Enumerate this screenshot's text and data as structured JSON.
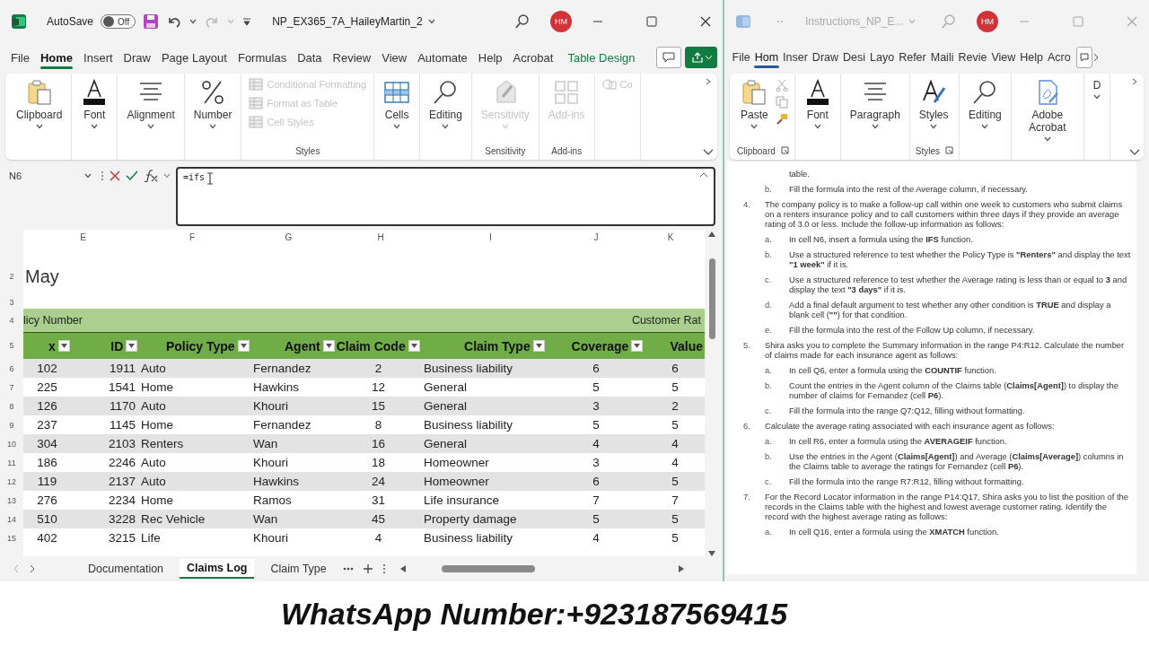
{
  "excel": {
    "active": true,
    "title_bar": {
      "autosave": {
        "label": "AutoSave",
        "state": "Off",
        "on": false
      },
      "file_name": "NP_EX365_7A_HaileyMartin_2",
      "avatar": "HM"
    },
    "tabs": [
      {
        "label": "File",
        "selected": false,
        "kind": "plain"
      },
      {
        "label": "Home",
        "selected": true,
        "kind": "plain"
      },
      {
        "label": "Insert",
        "selected": false,
        "kind": "plain"
      },
      {
        "label": "Draw",
        "selected": false,
        "kind": "plain"
      },
      {
        "label": "Page Layout",
        "selected": false,
        "kind": "plain"
      },
      {
        "label": "Formulas",
        "selected": false,
        "kind": "plain"
      },
      {
        "label": "Data",
        "selected": false,
        "kind": "plain"
      },
      {
        "label": "Review",
        "selected": false,
        "kind": "plain"
      },
      {
        "label": "View",
        "selected": false,
        "kind": "plain"
      },
      {
        "label": "Automate",
        "selected": false,
        "kind": "plain"
      },
      {
        "label": "Help",
        "selected": false,
        "kind": "plain"
      },
      {
        "label": "Acrobat",
        "selected": false,
        "kind": "plain"
      },
      {
        "label": "Table Design",
        "selected": false,
        "kind": "contextual"
      }
    ],
    "ribbon": [
      {
        "items": [
          {
            "label": "Clipboard",
            "kind": "big",
            "disabled": false
          }
        ]
      },
      {
        "items": [
          {
            "label": "Font",
            "kind": "big",
            "disabled": false
          }
        ]
      },
      {
        "items": [
          {
            "label": "Alignment",
            "kind": "big",
            "disabled": false
          }
        ]
      },
      {
        "items": [
          {
            "label": "Number",
            "kind": "big",
            "disabled": false
          }
        ]
      },
      {
        "label": "Styles",
        "items": [
          {
            "label": "Conditional Formatting",
            "kind": "small",
            "disabled": true
          },
          {
            "label": "Format as Table",
            "kind": "small",
            "disabled": true
          },
          {
            "label": "Cell Styles",
            "kind": "small",
            "disabled": true
          }
        ]
      },
      {
        "items": [
          {
            "label": "Cells",
            "kind": "big",
            "disabled": false
          }
        ]
      },
      {
        "items": [
          {
            "label": "Editing",
            "kind": "big",
            "disabled": false
          }
        ]
      },
      {
        "label": "Sensitivity",
        "items": [
          {
            "label": "Sensitivity",
            "kind": "big",
            "disabled": true
          }
        ]
      },
      {
        "label": "Add-ins",
        "items": [
          {
            "label": "Add-ins",
            "kind": "big",
            "disabled": true
          }
        ]
      },
      {
        "items": [
          {
            "label": "Co",
            "kind": "small",
            "disabled": true
          }
        ]
      }
    ],
    "formula_bar": {
      "name_box": "N6",
      "formula": "=ifs"
    },
    "sheet": {
      "column_letters": [
        "E",
        "F",
        "G",
        "H",
        "I",
        "J",
        "K"
      ],
      "title_row": {
        "row": "2",
        "text": "May"
      },
      "blank_row": {
        "row": "3"
      },
      "band_row": {
        "row": "4",
        "left": "licy Number",
        "right": "Customer Rat"
      },
      "header_row": {
        "row": "5",
        "cells": [
          "x",
          "ID",
          "Policy Type",
          "Agent",
          "Claim Code",
          "Claim Type",
          "Coverage",
          "Value"
        ]
      },
      "rows": [
        {
          "row": "6",
          "cells": [
            "102",
            "1911",
            "Auto",
            "Fernandez",
            "2",
            "Business liability",
            "6",
            "6"
          ]
        },
        {
          "row": "7",
          "cells": [
            "225",
            "1541",
            "Home",
            "Hawkins",
            "12",
            "General",
            "5",
            "5"
          ]
        },
        {
          "row": "8",
          "cells": [
            "126",
            "1170",
            "Auto",
            "Khouri",
            "15",
            "General",
            "3",
            "2"
          ]
        },
        {
          "row": "9",
          "cells": [
            "237",
            "1145",
            "Home",
            "Fernandez",
            "8",
            "Business liability",
            "5",
            "5"
          ]
        },
        {
          "row": "10",
          "cells": [
            "304",
            "2103",
            "Renters",
            "Wan",
            "16",
            "General",
            "4",
            "4"
          ]
        },
        {
          "row": "11",
          "cells": [
            "186",
            "2246",
            "Auto",
            "Khouri",
            "18",
            "Homeowner",
            "3",
            "4"
          ]
        },
        {
          "row": "12",
          "cells": [
            "119",
            "2137",
            "Auto",
            "Hawkins",
            "24",
            "Homeowner",
            "6",
            "5"
          ]
        },
        {
          "row": "13",
          "cells": [
            "276",
            "2234",
            "Home",
            "Ramos",
            "31",
            "Life insurance",
            "7",
            "7"
          ]
        },
        {
          "row": "14",
          "cells": [
            "510",
            "3228",
            "Rec Vehicle",
            "Wan",
            "45",
            "Property damage",
            "5",
            "5"
          ]
        },
        {
          "row": "15",
          "cells": [
            "402",
            "3215",
            "Life",
            "Khouri",
            "4",
            "Business liability",
            "4",
            "5"
          ]
        }
      ]
    },
    "sheet_tabs": [
      {
        "label": "Documentation",
        "selected": false
      },
      {
        "label": "Claims Log",
        "selected": true
      },
      {
        "label": "Claim Type",
        "selected": false
      }
    ]
  },
  "word": {
    "active": false,
    "title_bar": {
      "file_name": "Instructions_NP_E...",
      "avatar": "HM"
    },
    "tabs": [
      {
        "label": "File",
        "selected": false
      },
      {
        "label": "Hom",
        "selected": true
      },
      {
        "label": "Inser",
        "selected": false
      },
      {
        "label": "Draw",
        "selected": false
      },
      {
        "label": "Desi",
        "selected": false
      },
      {
        "label": "Layo",
        "selected": false
      },
      {
        "label": "Refer",
        "selected": false
      },
      {
        "label": "Maili",
        "selected": false
      },
      {
        "label": "Revie",
        "selected": false
      },
      {
        "label": "View",
        "selected": false
      },
      {
        "label": "Help",
        "selected": false
      },
      {
        "label": "Acro",
        "selected": false
      }
    ],
    "ribbon": [
      {
        "label": "Clipboard",
        "items": [
          {
            "label": "Paste"
          }
        ]
      },
      {
        "items": [
          {
            "label": "Font"
          }
        ]
      },
      {
        "items": [
          {
            "label": "Paragraph"
          }
        ]
      },
      {
        "label": "Styles",
        "items": [
          {
            "label": "Styles"
          }
        ]
      },
      {
        "items": [
          {
            "label": "Editing"
          }
        ]
      },
      {
        "items": [
          {
            "label": "Adobe Acrobat"
          }
        ]
      },
      {
        "items": [
          {
            "label": "D"
          }
        ]
      }
    ],
    "document": [
      {
        "children": [
          {
            "text": "table."
          },
          {
            "marker": "b.",
            "text": "Fill the formula into the rest of the Average column, if necessary."
          }
        ]
      },
      {
        "marker": "4.",
        "text": "The company policy is to make a follow-up call within one week to customers who submit claims on a renters insurance policy and to call customers within three days if they provide an average rating of 3.0 or less. Include the follow-up information as follows:",
        "children": [
          {
            "marker": "a.",
            "text": "In cell N6, insert a formula using the **IFS** function."
          },
          {
            "marker": "b.",
            "text": "Use a structured reference to test whether the Policy Type is **\"Renters\"** and display the text **\"1 week\"** if it is."
          },
          {
            "marker": "c.",
            "text": "Use a structured reference to test whether the Average rating is less than or equal to **3** and display the text **\"3 days\"** if it is."
          },
          {
            "marker": "d.",
            "text": "Add a final default argument to test whether any other condition is **TRUE** and display a blank cell (**\"\"**) for that condition."
          },
          {
            "marker": "e.",
            "text": "Fill the formula into the rest of the Follow Up column, if necessary."
          }
        ]
      },
      {
        "marker": "5.",
        "text": "Shira asks you to complete the Summary information in the range P4:R12. Calculate the number of claims made for each insurance agent as follows:",
        "children": [
          {
            "marker": "a.",
            "text": "In cell Q6, enter a formula using the **COUNTIF** function."
          },
          {
            "marker": "b.",
            "text": "Count the entries in the Agent column of the Claims table (**Claims[Agent]**) to display the number of claims for Fernandez (cell **P6**)."
          },
          {
            "marker": "c.",
            "text": "Fill the formula into the range Q7:Q12, filling without formatting."
          }
        ]
      },
      {
        "marker": "6.",
        "text": "Calculate the average rating associated with each insurance agent as follows:",
        "children": [
          {
            "marker": "a.",
            "text": "In cell R6, enter a formula using the **AVERAGEIF** function."
          },
          {
            "marker": "b.",
            "text": "Use the entries in the Agent (**Claims[Agent]**) and Average (**Claims[Average]**) columns in the Claims table to average the ratings for Fernandez (cell **P6**)."
          },
          {
            "marker": "c.",
            "text": "Fill the formula into the range R7:R12, filling without formatting."
          }
        ]
      },
      {
        "marker": "7.",
        "text": "For the Record Locator information in the range P14:Q17, Shira asks you to list the position of the records in the Claims table with the highest and lowest average customer rating. Identify the record with the highest average rating as follows:",
        "children": [
          {
            "marker": "a.",
            "text": "In cell Q16, enter a formula using the **XMATCH** function."
          }
        ]
      }
    ]
  },
  "caption": {
    "text": "WhatsApp Number:+923187569415"
  }
}
